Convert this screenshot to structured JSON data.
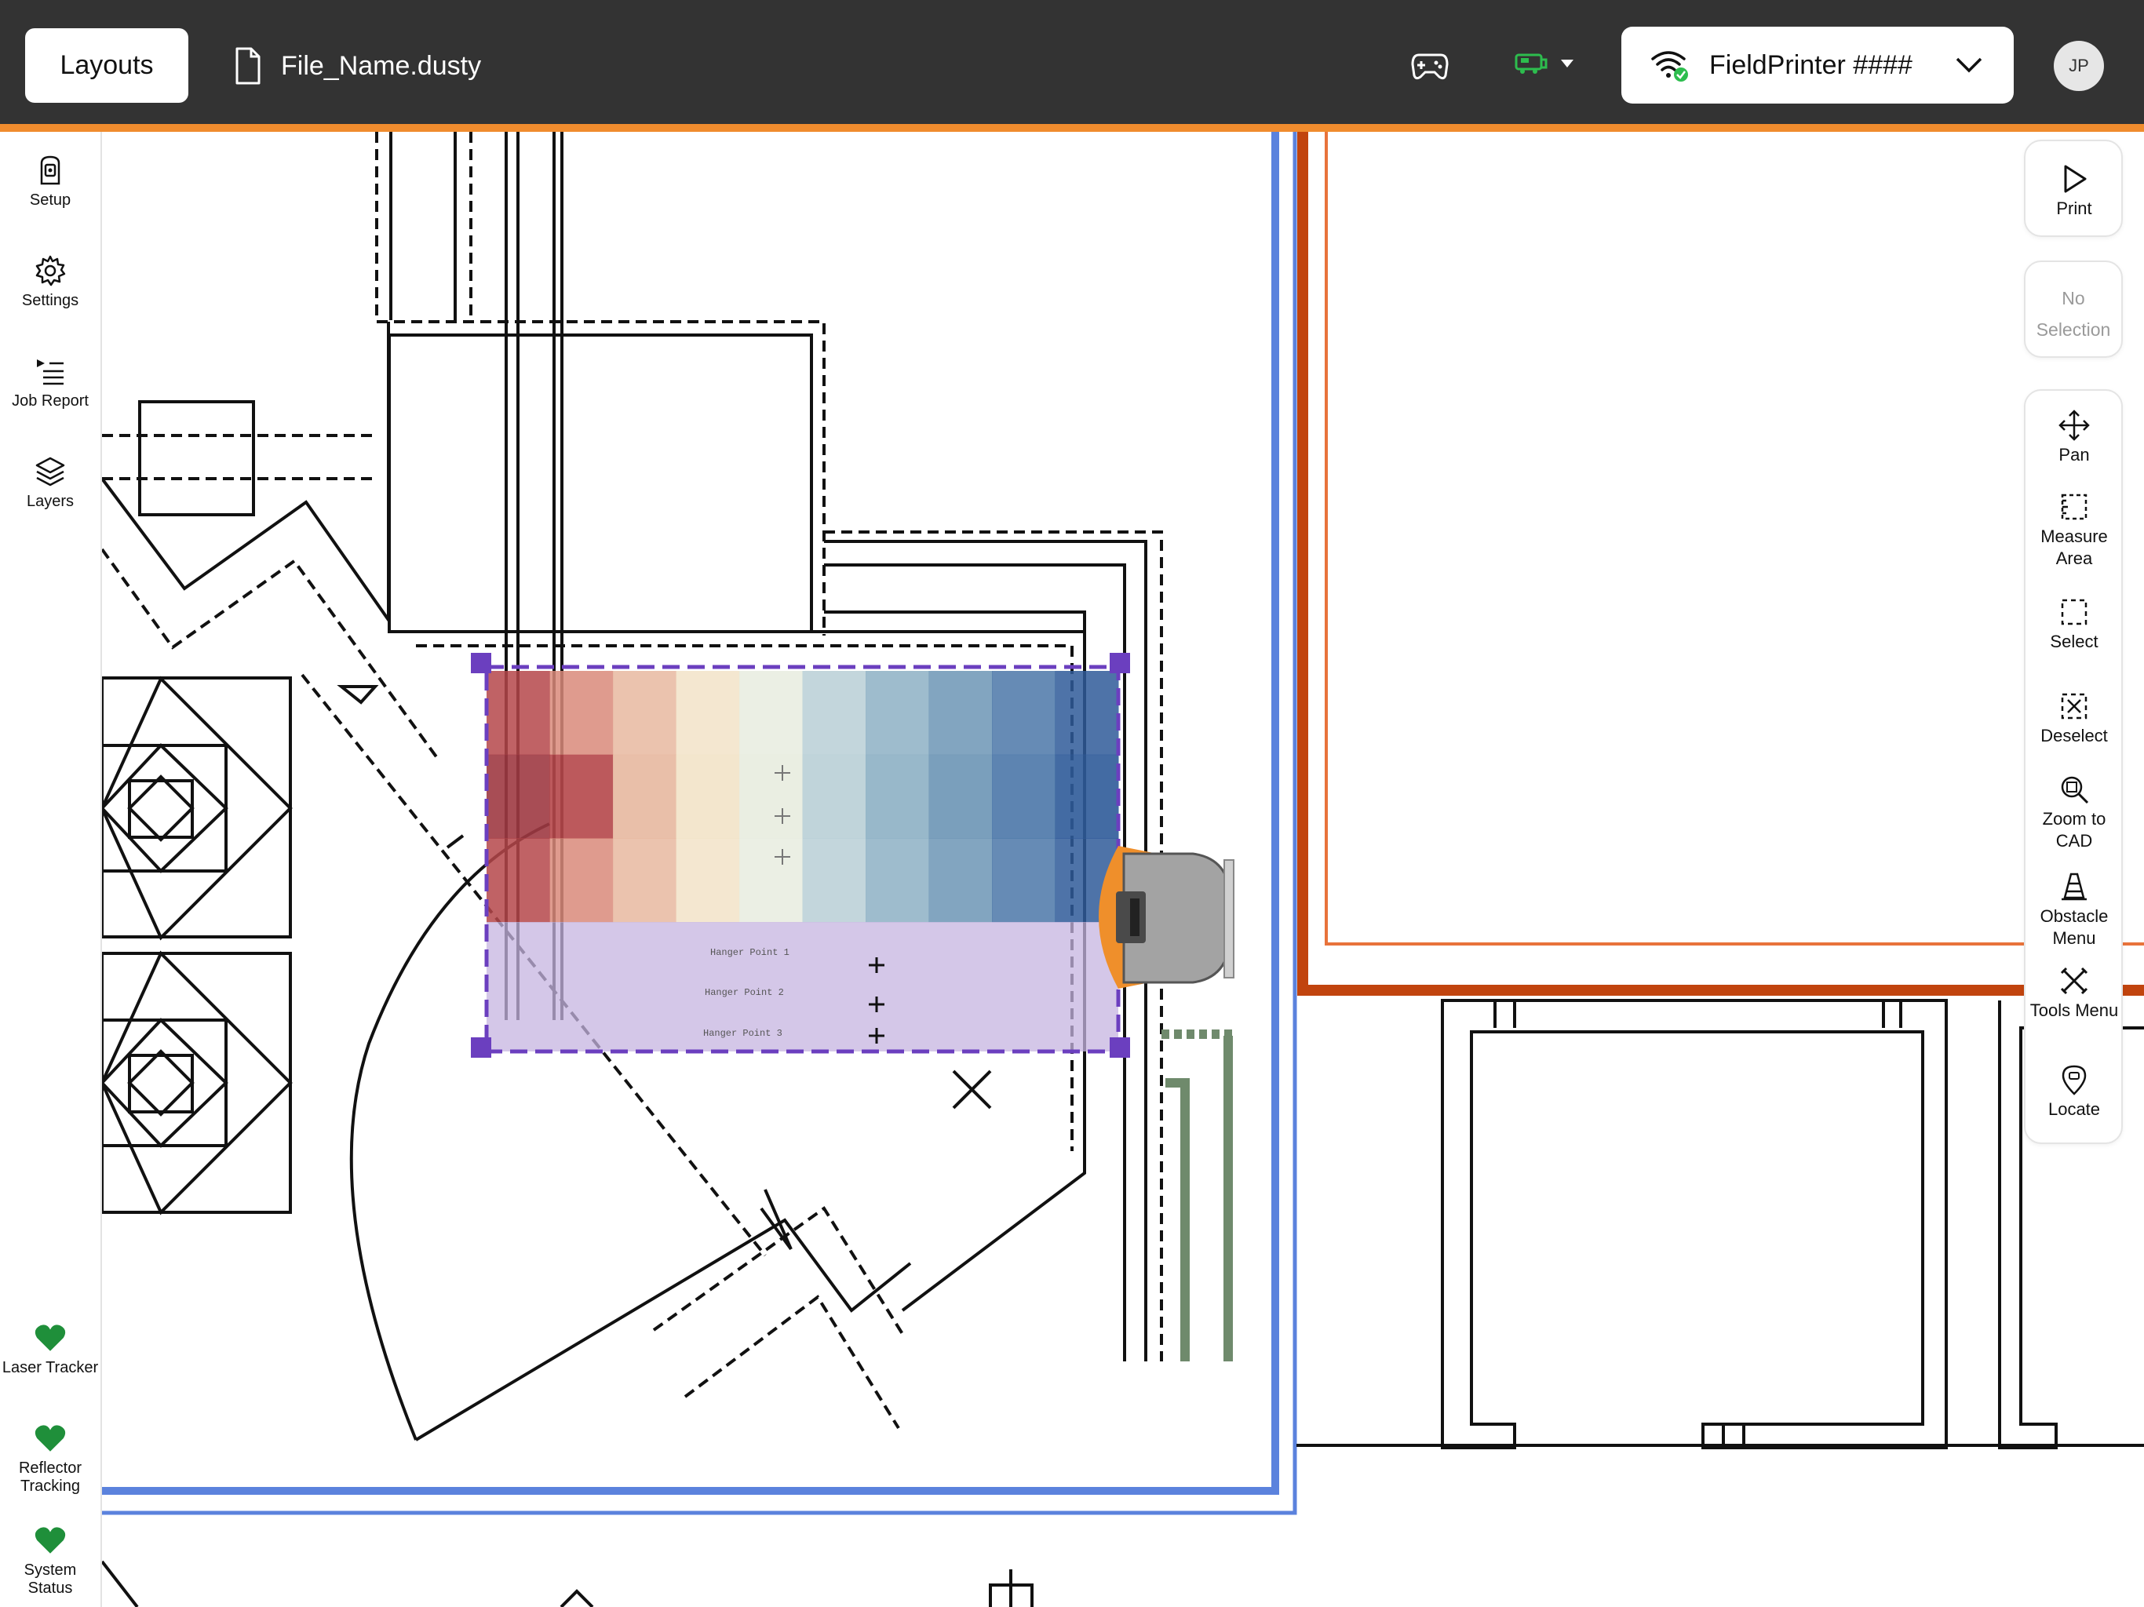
{
  "header": {
    "layouts_label": "Layouts",
    "file_name": "File_Name.dusty",
    "device_name": "FieldPrinter ####",
    "user_initials": "JP",
    "colors": {
      "bar": "#333333",
      "accent": "#f08c2e",
      "connected": "#2dbd4e"
    }
  },
  "sidebar": {
    "items": [
      {
        "label": "Setup",
        "icon": "rover-icon"
      },
      {
        "label": "Settings",
        "icon": "gear-icon"
      },
      {
        "label": "Job Report",
        "icon": "list-play-icon"
      },
      {
        "label": "Layers",
        "icon": "layers-icon"
      }
    ],
    "status": [
      {
        "label": "Laser Tracker",
        "icon": "heart-icon",
        "color": "#1f8f3a"
      },
      {
        "label": "Reflector Tracking",
        "icon": "heart-icon",
        "color": "#1f8f3a"
      },
      {
        "label": "System Status",
        "icon": "heart-icon",
        "color": "#1f8f3a"
      }
    ]
  },
  "toolbar": {
    "print_label": "Print",
    "selection_label": "No Selection",
    "tools": [
      {
        "label": "Pan",
        "icon": "move-arrows-icon"
      },
      {
        "label": "Measure Area",
        "icon": "measure-area-icon"
      },
      {
        "label": "Select",
        "icon": "select-box-icon"
      },
      {
        "label": "Deselect",
        "icon": "deselect-box-icon"
      },
      {
        "label": "Zoom to CAD",
        "icon": "zoom-icon"
      },
      {
        "label": "Obstacle Menu",
        "icon": "cone-icon"
      },
      {
        "label": "Tools Menu",
        "icon": "tools-icon"
      },
      {
        "label": "Locate",
        "icon": "location-pin-icon"
      }
    ]
  },
  "cad": {
    "annotations": [
      "Hanger Point 1",
      "Hanger Point 2",
      "Hanger Point 3"
    ],
    "selection_color": "#7a4fc4",
    "heatmap_colors": [
      "#b5474a",
      "#d98a7a",
      "#e7b8a0",
      "#f2e3c8",
      "#e8ecdf",
      "#b9cfd6",
      "#8db0c4",
      "#6c95b5",
      "#4b77a8",
      "#2f5b99"
    ]
  }
}
